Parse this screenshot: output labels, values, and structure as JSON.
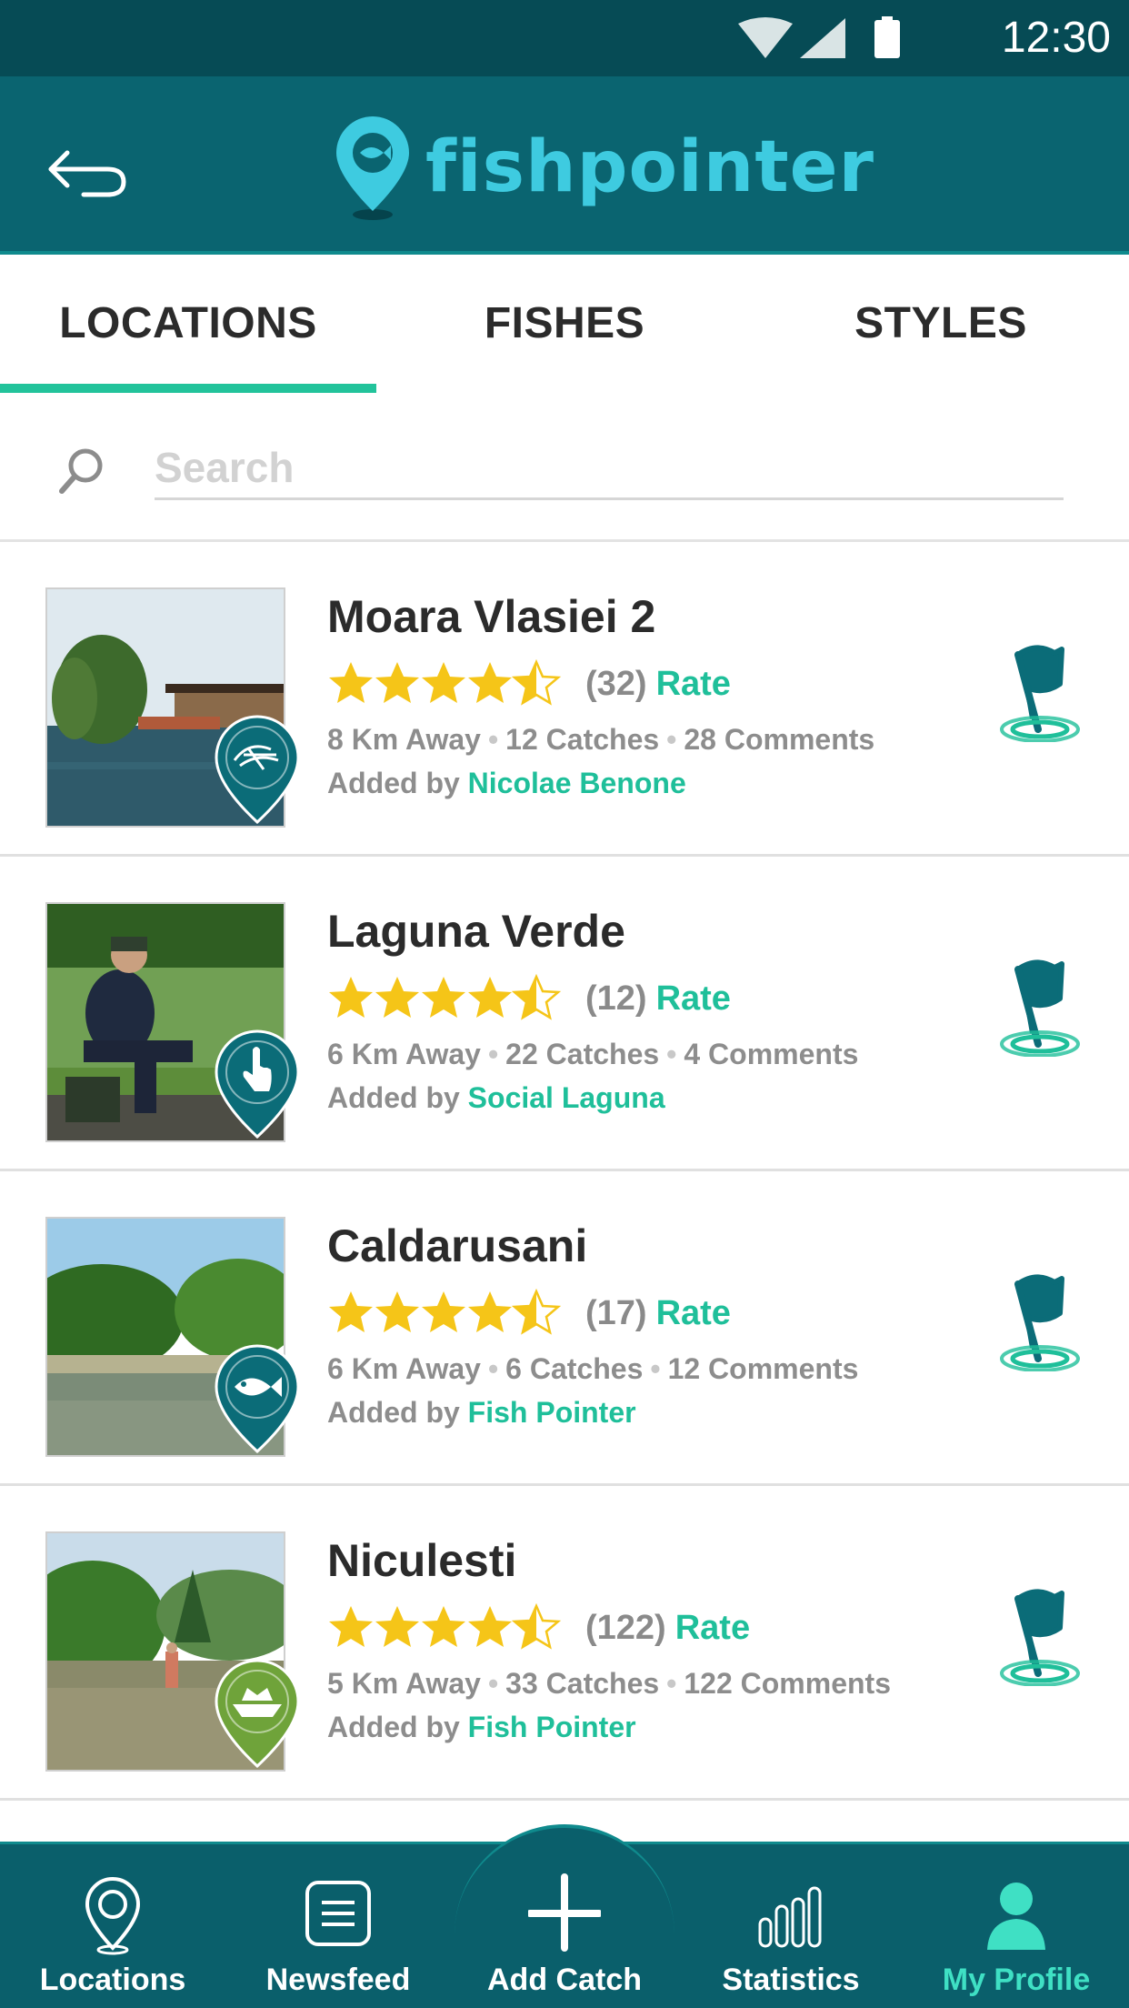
{
  "status_bar": {
    "time": "12:30"
  },
  "app": {
    "brand": "fishpointer"
  },
  "tabs": [
    {
      "label": "LOCATIONS"
    },
    {
      "label": "FISHES"
    },
    {
      "label": "STYLES"
    }
  ],
  "search": {
    "placeholder": "Search"
  },
  "locations": [
    {
      "name": "Moara Vlasiei 2",
      "rating": 4.5,
      "count": "(32)",
      "rate_label": "Rate",
      "distance": "8 Km Away",
      "catches": "12 Catches",
      "comments": "28 Comments",
      "added_prefix": "Added by",
      "author": "Nicolae Benone",
      "badge": "fly-icon",
      "badge_color": "#0b6c78"
    },
    {
      "name": "Laguna Verde",
      "rating": 4.5,
      "count": "(12)",
      "rate_label": "Rate",
      "distance": "6 Km Away",
      "catches": "22 Catches",
      "comments": "4 Comments",
      "added_prefix": "Added by",
      "author": "Social Laguna",
      "badge": "hand-pointer-icon",
      "badge_color": "#0b6c78"
    },
    {
      "name": "Caldarusani",
      "rating": 4.5,
      "count": "(17)",
      "rate_label": "Rate",
      "distance": "6 Km Away",
      "catches": "6 Catches",
      "comments": "12 Comments",
      "added_prefix": "Added by",
      "author": "Fish Pointer",
      "badge": "fish-icon",
      "badge_color": "#0b6c78"
    },
    {
      "name": "Niculesti",
      "rating": 4.5,
      "count": "(122)",
      "rate_label": "Rate",
      "distance": "5 Km Away",
      "catches": "33 Catches",
      "comments": "122 Comments",
      "added_prefix": "Added by",
      "author": "Fish Pointer",
      "badge": "boat-icon",
      "badge_color": "#6fa33a"
    }
  ],
  "bottom_nav": [
    {
      "label": "Locations",
      "icon": "location-pin-icon"
    },
    {
      "label": "Newsfeed",
      "icon": "newsfeed-icon"
    },
    {
      "label": "Add Catch",
      "icon": "plus-icon"
    },
    {
      "label": "Statistics",
      "icon": "bar-chart-icon"
    },
    {
      "label": "My Profile",
      "icon": "user-icon",
      "active": true
    }
  ],
  "colors": {
    "primary_dark": "#064b55",
    "primary": "#0a6470",
    "accent": "#1fbf9a",
    "star": "#f5c518"
  }
}
